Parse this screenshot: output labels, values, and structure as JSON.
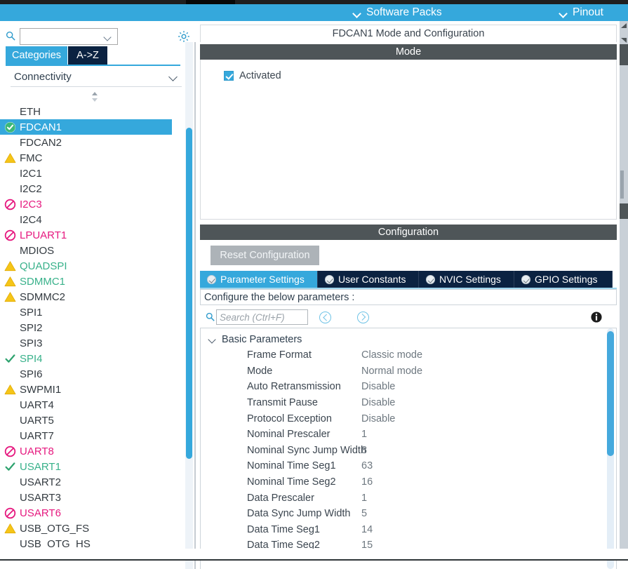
{
  "menubar": {
    "software_packs": "Software Packs",
    "pinout": "Pinout"
  },
  "left_panel": {
    "search": {
      "value": "",
      "placeholder": ""
    },
    "gear_icon": "gear-icon",
    "tabs": [
      {
        "label": "Categories",
        "active": true
      },
      {
        "label": "A->Z",
        "active": false
      }
    ],
    "group": {
      "label": "Connectivity",
      "expanded": true
    },
    "peripherals": [
      {
        "label": "ETH",
        "status": "none",
        "color": "dark",
        "selected": false
      },
      {
        "label": "FDCAN1",
        "status": "check-circle",
        "color": "white",
        "selected": true
      },
      {
        "label": "FDCAN2",
        "status": "none",
        "color": "dark",
        "selected": false
      },
      {
        "label": "FMC",
        "status": "warning",
        "color": "dark",
        "selected": false
      },
      {
        "label": "I2C1",
        "status": "none",
        "color": "dark",
        "selected": false
      },
      {
        "label": "I2C2",
        "status": "none",
        "color": "dark",
        "selected": false
      },
      {
        "label": "I2C3",
        "status": "forbidden",
        "color": "pink",
        "selected": false
      },
      {
        "label": "I2C4",
        "status": "none",
        "color": "dark",
        "selected": false
      },
      {
        "label": "LPUART1",
        "status": "forbidden",
        "color": "pink",
        "selected": false
      },
      {
        "label": "MDIOS",
        "status": "none",
        "color": "dark",
        "selected": false
      },
      {
        "label": "QUADSPI",
        "status": "warning",
        "color": "green",
        "selected": false
      },
      {
        "label": "SDMMC1",
        "status": "warning",
        "color": "green",
        "selected": false
      },
      {
        "label": "SDMMC2",
        "status": "warning",
        "color": "dark",
        "selected": false
      },
      {
        "label": "SPI1",
        "status": "none",
        "color": "dark",
        "selected": false
      },
      {
        "label": "SPI2",
        "status": "none",
        "color": "dark",
        "selected": false
      },
      {
        "label": "SPI3",
        "status": "none",
        "color": "dark",
        "selected": false
      },
      {
        "label": "SPI4",
        "status": "tick",
        "color": "green",
        "selected": false
      },
      {
        "label": "SPI6",
        "status": "none",
        "color": "dark",
        "selected": false
      },
      {
        "label": "SWPMI1",
        "status": "warning",
        "color": "dark",
        "selected": false
      },
      {
        "label": "UART4",
        "status": "none",
        "color": "dark",
        "selected": false
      },
      {
        "label": "UART5",
        "status": "none",
        "color": "dark",
        "selected": false
      },
      {
        "label": "UART7",
        "status": "none",
        "color": "dark",
        "selected": false
      },
      {
        "label": "UART8",
        "status": "forbidden",
        "color": "pink",
        "selected": false
      },
      {
        "label": "USART1",
        "status": "tick",
        "color": "green",
        "selected": false
      },
      {
        "label": "USART2",
        "status": "none",
        "color": "dark",
        "selected": false
      },
      {
        "label": "USART3",
        "status": "none",
        "color": "dark",
        "selected": false
      },
      {
        "label": "USART6",
        "status": "forbidden",
        "color": "pink",
        "selected": false
      },
      {
        "label": "USB_OTG_FS",
        "status": "warning",
        "color": "dark",
        "selected": false
      },
      {
        "label": "USB_OTG_HS",
        "status": "none",
        "color": "dark",
        "selected": false
      }
    ]
  },
  "right_panel": {
    "title": "FDCAN1 Mode and Configuration",
    "mode": {
      "header": "Mode",
      "activated_label": "Activated",
      "activated_checked": true
    },
    "configuration": {
      "header": "Configuration",
      "reset_button": "Reset Configuration",
      "tabs": [
        {
          "label": "Parameter Settings",
          "active": true
        },
        {
          "label": "User Constants",
          "active": false
        },
        {
          "label": "NVIC Settings",
          "active": false
        },
        {
          "label": "GPIO Settings",
          "active": false
        }
      ],
      "hint": "Configure the below parameters :",
      "search": {
        "value": "",
        "placeholder": "Search (Ctrl+F)"
      },
      "parameters": {
        "group_label": "Basic Parameters",
        "rows": [
          {
            "name": "Frame Format",
            "value": "Classic mode"
          },
          {
            "name": "Mode",
            "value": "Normal mode"
          },
          {
            "name": "Auto Retransmission",
            "value": "Disable"
          },
          {
            "name": "Transmit Pause",
            "value": "Disable"
          },
          {
            "name": "Protocol Exception",
            "value": "Disable"
          },
          {
            "name": "Nominal Prescaler",
            "value": "1"
          },
          {
            "name": "Nominal Sync Jump Width",
            "value": "8"
          },
          {
            "name": "Nominal Time Seg1",
            "value": "63"
          },
          {
            "name": "Nominal Time Seg2",
            "value": "16"
          },
          {
            "name": "Data Prescaler",
            "value": "1"
          },
          {
            "name": "Data Sync Jump Width",
            "value": "5"
          },
          {
            "name": "Data Time Seg1",
            "value": "14"
          },
          {
            "name": "Data Time Seg2",
            "value": "15"
          }
        ]
      }
    }
  },
  "colors": {
    "accent_blue": "#35a8dc",
    "navy": "#0b2241",
    "header_gray": "#4e5558",
    "warning_yellow": "#f5c518",
    "forbidden_pink": "#e6197f",
    "ok_green": "#38b18a"
  }
}
